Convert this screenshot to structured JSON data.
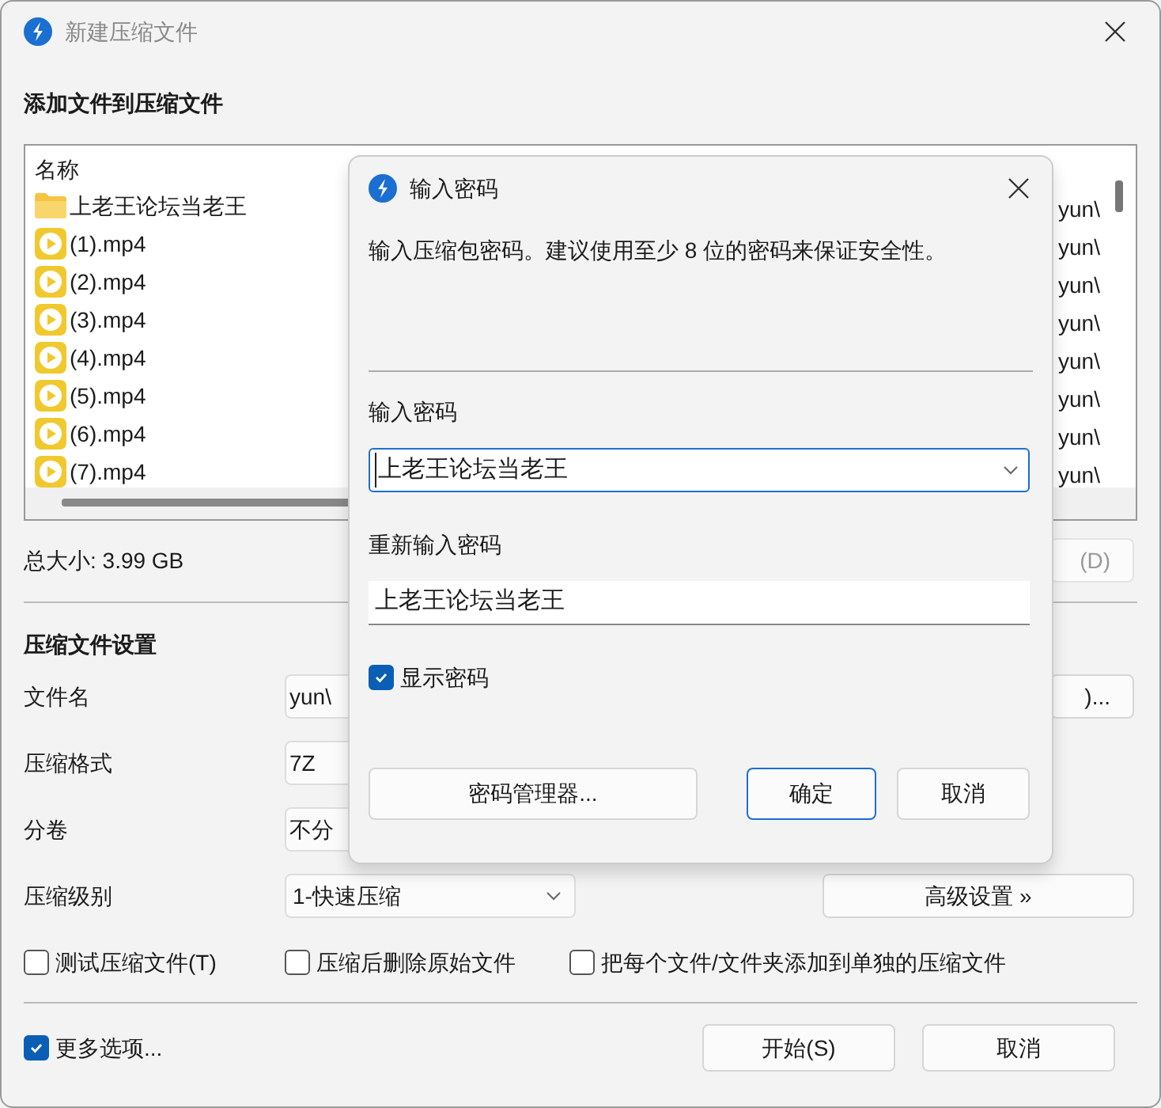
{
  "window": {
    "title": "新建压缩文件"
  },
  "files": {
    "heading": "添加文件到压缩文件",
    "column_1": "名称",
    "rows": [
      {
        "kind": "folder",
        "name": "上老王论坛当老王",
        "column_4": "yun\\"
      },
      {
        "kind": "video",
        "name": "(1).mp4",
        "column_4": "yun\\"
      },
      {
        "kind": "video",
        "name": "(2).mp4",
        "column_4": "yun\\"
      },
      {
        "kind": "video",
        "name": "(3).mp4",
        "column_4": "yun\\"
      },
      {
        "kind": "video",
        "name": "(4).mp4",
        "column_4": "yun\\"
      },
      {
        "kind": "video",
        "name": "(5).mp4",
        "column_4": "yun\\"
      },
      {
        "kind": "video",
        "name": "(6).mp4",
        "column_4": "yun\\"
      },
      {
        "kind": "video",
        "name": "(7).mp4",
        "column_4": "yun\\"
      }
    ]
  },
  "total_size": "总大小: 3.99 GB",
  "total_button": "(D)",
  "settings": {
    "heading": "压缩文件设置",
    "rows": [
      {
        "kind": "field",
        "label": "文件名",
        "value": "yun\\",
        "button": ")..."
      },
      {
        "kind": "field",
        "label": "压缩格式",
        "value": "7Z"
      },
      {
        "kind": "field",
        "label": "分卷",
        "value": "不分"
      },
      {
        "kind": "select",
        "label": "压缩级别",
        "value": "1-快速压缩",
        "button": "高级设置 »"
      }
    ],
    "options": [
      {
        "label": "测试压缩文件(T)",
        "checked": false
      },
      {
        "label": "压缩后删除原始文件",
        "checked": false
      },
      {
        "label": "把每个文件/文件夹添加到单独的压缩文件",
        "checked": false
      }
    ]
  },
  "more_options": {
    "label": "更多选项...",
    "checked": true
  },
  "buttons": [
    "开始(S)",
    "取消"
  ],
  "dialog": {
    "title": "输入密码",
    "message": "输入压缩包密码。建议使用至少 8 位的密码来保证安全性。",
    "password_label": "输入密码",
    "password": "上老王论坛当老王",
    "confirm_label": "重新输入密码",
    "confirm": "上老王论坛当老王",
    "show_password": {
      "label": "显示密码",
      "checked": true
    },
    "manager_button": "密码管理器...",
    "buttons": [
      "确定",
      "取消"
    ]
  }
}
